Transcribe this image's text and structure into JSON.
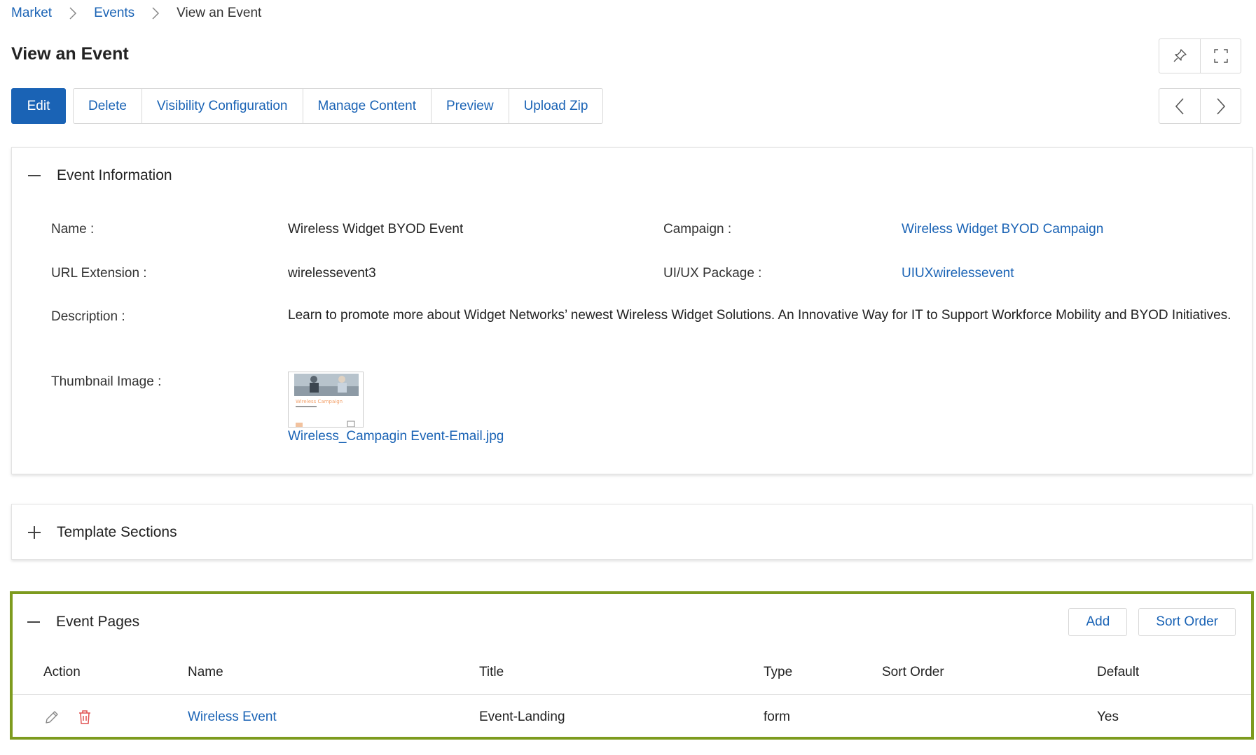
{
  "breadcrumb": {
    "items": [
      "Market",
      "Events"
    ],
    "current": "View an Event"
  },
  "page_title": "View an Event",
  "icons": {
    "pin": "pin-icon",
    "fullscreen": "fullscreen-icon",
    "prev": "chevron-left-icon",
    "next": "chevron-right-icon",
    "collapse": "minus-icon",
    "expand": "plus-icon",
    "edit": "pencil-icon",
    "delete": "trash-icon"
  },
  "toolbar": {
    "edit": "Edit",
    "delete": "Delete",
    "visibility": "Visibility Configuration",
    "manage_content": "Manage Content",
    "preview": "Preview",
    "upload_zip": "Upload Zip"
  },
  "event_info": {
    "title": "Event Information",
    "name_label": "Name :",
    "name_value": "Wireless Widget BYOD Event",
    "campaign_label": "Campaign :",
    "campaign_value": "Wireless Widget BYOD Campaign",
    "url_label": "URL Extension :",
    "url_value": "wirelessevent3",
    "uiux_label": "UI/UX Package :",
    "uiux_value": "UIUXwirelessevent",
    "description_label": "Description :",
    "description_value": "Learn to promote more about Widget Networks’ newest Wireless Widget Solutions. An Innovative Way for IT to Support Workforce Mobility and BYOD Initiatives.",
    "thumbnail_label": "Thumbnail Image :",
    "thumbnail_file": "Wireless_Campagin Event-Email.jpg",
    "thumbnail_caption": "Wireless Campaign"
  },
  "template_sections": {
    "title": "Template Sections"
  },
  "event_pages": {
    "title": "Event Pages",
    "add": "Add",
    "sort_order": "Sort Order",
    "columns": {
      "action": "Action",
      "name": "Name",
      "title": "Title",
      "type": "Type",
      "sort_order": "Sort Order",
      "default": "Default"
    },
    "rows": [
      {
        "name": "Wireless Event",
        "title": "Event-Landing",
        "type": "form",
        "sort_order": "",
        "default": "Yes"
      }
    ]
  },
  "colors": {
    "primary": "#1a63b5",
    "highlight_border": "#7d9b1e",
    "delete_icon": "#e05252"
  }
}
